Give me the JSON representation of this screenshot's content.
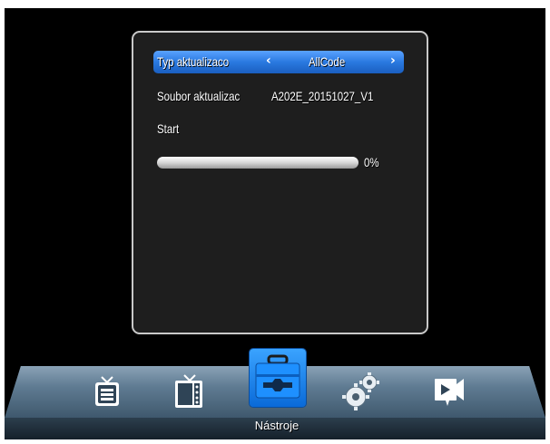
{
  "dialog": {
    "update_type_label": "Typ aktualizaco",
    "update_type_value": "AllCode",
    "left_arrow": "‹",
    "right_arrow": "›",
    "file_label": "Soubor aktualizac",
    "file_value": "A202E_20151027_V1",
    "start_label": "Start",
    "progress_text": "0%",
    "progress_value": 0
  },
  "menu": {
    "active_label": "Nástroje",
    "items": [
      {
        "icon": "tv-list-icon"
      },
      {
        "icon": "tv-remote-icon"
      },
      {
        "icon": "toolbox-icon"
      },
      {
        "icon": "gears-icon"
      },
      {
        "icon": "media-play-icon"
      }
    ]
  },
  "colors": {
    "highlight": "#2a79e0",
    "background": "#000000",
    "panel": "#1e1e1e"
  }
}
